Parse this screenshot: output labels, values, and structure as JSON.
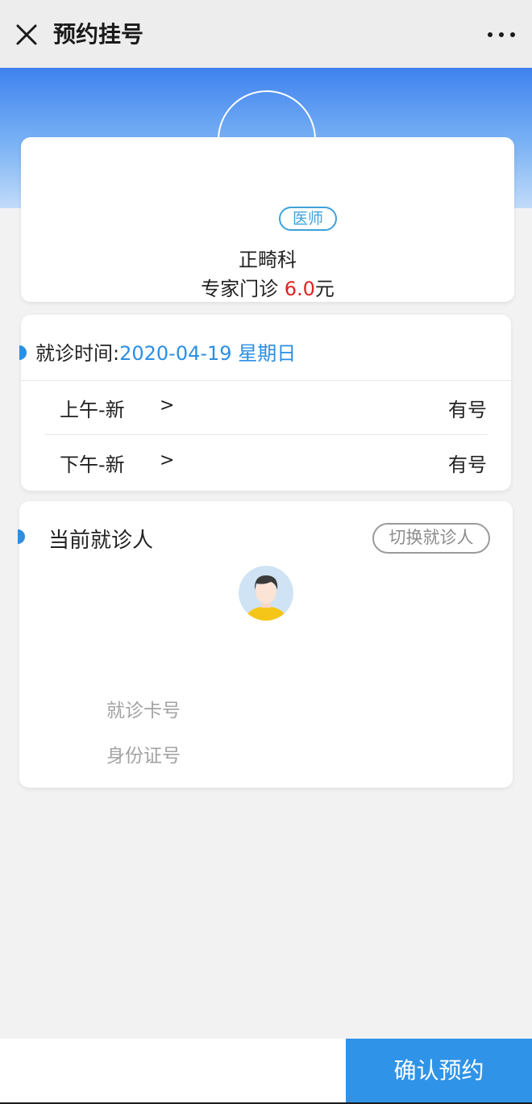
{
  "header": {
    "title": "预约挂号"
  },
  "doctor": {
    "badge": "医师",
    "department": "正畸科",
    "clinic_prefix": "专家门诊 ",
    "price": "6.0",
    "currency": "元"
  },
  "visit_time": {
    "label": "就诊时间:",
    "date": "2020-04-19 星期日",
    "slots": [
      {
        "name": "上午-新",
        "arrow": ">",
        "status": "有号"
      },
      {
        "name": "下午-新",
        "arrow": ">",
        "status": "有号"
      }
    ]
  },
  "patient": {
    "title": "当前就诊人",
    "switch_label": "切换就诊人",
    "card_number_label": "就诊卡号",
    "id_number_label": "身份证号"
  },
  "footer": {
    "confirm_label": "确认预约"
  },
  "colors": {
    "accent_blue": "#2f93e8",
    "price_red": "#e02424",
    "badge_blue": "#3ea1d9"
  },
  "icons": [
    "close-icon",
    "more-icon",
    "avatar-icon",
    "section-marker-icon"
  ]
}
